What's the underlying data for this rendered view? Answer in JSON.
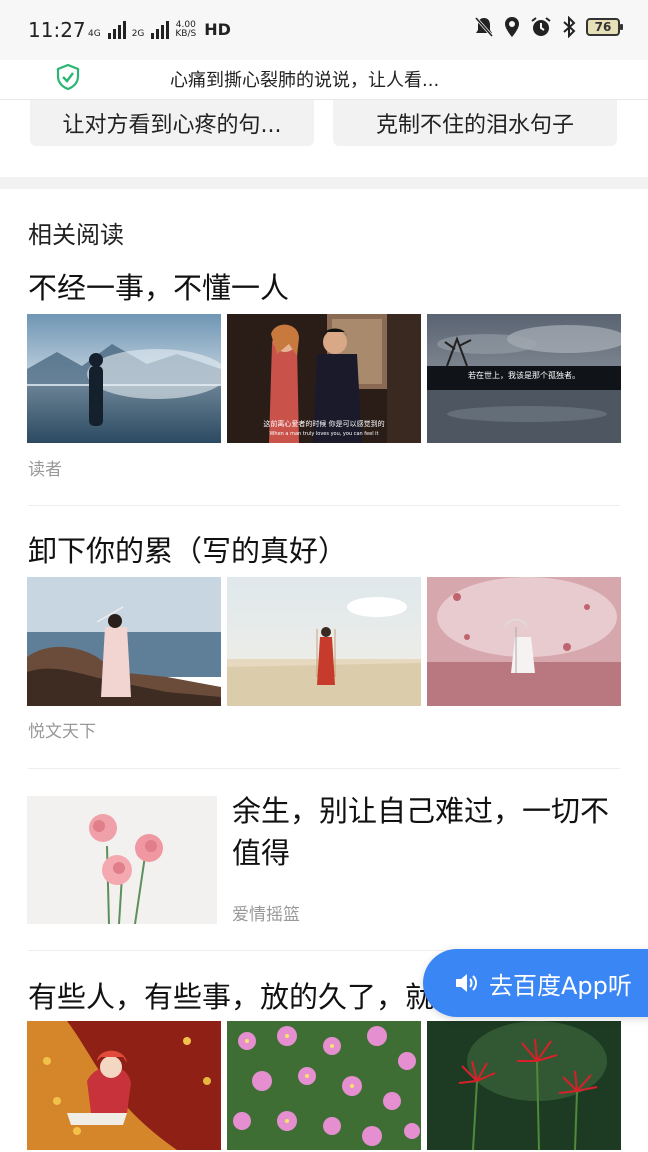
{
  "status": {
    "time": "11:27",
    "net1": "4G",
    "net2": "2G",
    "speed_value": "4.00",
    "speed_unit": "KB/S",
    "hd": "HD",
    "battery": "76"
  },
  "header": {
    "title": "心痛到撕心裂肺的说说，让人看..."
  },
  "suggestions": [
    "让对方看到心疼的句...",
    "克制不住的泪水句子"
  ],
  "related": {
    "section_title": "相关阅读",
    "articles": [
      {
        "title": "不经一事，不懂一人",
        "source": "读者"
      },
      {
        "title": "卸下你的累（写的真好）",
        "source": "悦文天下"
      },
      {
        "title": "余生，别让自己难过，一切不值得",
        "source": "爱情摇篮"
      },
      {
        "title": "有些人，有些事，放的久了，就没必要再..."
      }
    ]
  },
  "thumb_captions": {
    "couple": "这前离心爱者的时候 你是可以感觉到的",
    "couple_en": "When a man truly loves you, you can feel it",
    "sky": "若在世上，我该是那个孤独者。"
  },
  "float_button": {
    "label": "去百度App听"
  },
  "colors": {
    "accent": "#3a86f5",
    "shield": "#2bb673",
    "source_gray": "#999999"
  }
}
